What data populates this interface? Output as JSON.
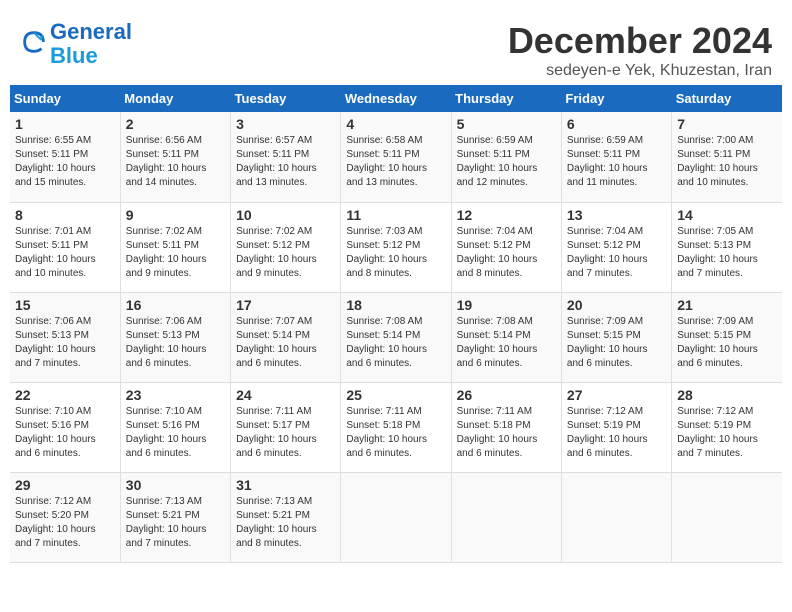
{
  "header": {
    "logo_line1": "General",
    "logo_line2": "Blue",
    "title": "December 2024",
    "subtitle": "sedeyen-e Yek, Khuzestan, Iran"
  },
  "weekdays": [
    "Sunday",
    "Monday",
    "Tuesday",
    "Wednesday",
    "Thursday",
    "Friday",
    "Saturday"
  ],
  "weeks": [
    [
      {
        "day": "1",
        "sunrise": "6:55 AM",
        "sunset": "5:11 PM",
        "daylight": "10 hours and 15 minutes."
      },
      {
        "day": "2",
        "sunrise": "6:56 AM",
        "sunset": "5:11 PM",
        "daylight": "10 hours and 14 minutes."
      },
      {
        "day": "3",
        "sunrise": "6:57 AM",
        "sunset": "5:11 PM",
        "daylight": "10 hours and 13 minutes."
      },
      {
        "day": "4",
        "sunrise": "6:58 AM",
        "sunset": "5:11 PM",
        "daylight": "10 hours and 13 minutes."
      },
      {
        "day": "5",
        "sunrise": "6:59 AM",
        "sunset": "5:11 PM",
        "daylight": "10 hours and 12 minutes."
      },
      {
        "day": "6",
        "sunrise": "6:59 AM",
        "sunset": "5:11 PM",
        "daylight": "10 hours and 11 minutes."
      },
      {
        "day": "7",
        "sunrise": "7:00 AM",
        "sunset": "5:11 PM",
        "daylight": "10 hours and 10 minutes."
      }
    ],
    [
      {
        "day": "8",
        "sunrise": "7:01 AM",
        "sunset": "5:11 PM",
        "daylight": "10 hours and 10 minutes."
      },
      {
        "day": "9",
        "sunrise": "7:02 AM",
        "sunset": "5:11 PM",
        "daylight": "10 hours and 9 minutes."
      },
      {
        "day": "10",
        "sunrise": "7:02 AM",
        "sunset": "5:12 PM",
        "daylight": "10 hours and 9 minutes."
      },
      {
        "day": "11",
        "sunrise": "7:03 AM",
        "sunset": "5:12 PM",
        "daylight": "10 hours and 8 minutes."
      },
      {
        "day": "12",
        "sunrise": "7:04 AM",
        "sunset": "5:12 PM",
        "daylight": "10 hours and 8 minutes."
      },
      {
        "day": "13",
        "sunrise": "7:04 AM",
        "sunset": "5:12 PM",
        "daylight": "10 hours and 7 minutes."
      },
      {
        "day": "14",
        "sunrise": "7:05 AM",
        "sunset": "5:13 PM",
        "daylight": "10 hours and 7 minutes."
      }
    ],
    [
      {
        "day": "15",
        "sunrise": "7:06 AM",
        "sunset": "5:13 PM",
        "daylight": "10 hours and 7 minutes."
      },
      {
        "day": "16",
        "sunrise": "7:06 AM",
        "sunset": "5:13 PM",
        "daylight": "10 hours and 6 minutes."
      },
      {
        "day": "17",
        "sunrise": "7:07 AM",
        "sunset": "5:14 PM",
        "daylight": "10 hours and 6 minutes."
      },
      {
        "day": "18",
        "sunrise": "7:08 AM",
        "sunset": "5:14 PM",
        "daylight": "10 hours and 6 minutes."
      },
      {
        "day": "19",
        "sunrise": "7:08 AM",
        "sunset": "5:14 PM",
        "daylight": "10 hours and 6 minutes."
      },
      {
        "day": "20",
        "sunrise": "7:09 AM",
        "sunset": "5:15 PM",
        "daylight": "10 hours and 6 minutes."
      },
      {
        "day": "21",
        "sunrise": "7:09 AM",
        "sunset": "5:15 PM",
        "daylight": "10 hours and 6 minutes."
      }
    ],
    [
      {
        "day": "22",
        "sunrise": "7:10 AM",
        "sunset": "5:16 PM",
        "daylight": "10 hours and 6 minutes."
      },
      {
        "day": "23",
        "sunrise": "7:10 AM",
        "sunset": "5:16 PM",
        "daylight": "10 hours and 6 minutes."
      },
      {
        "day": "24",
        "sunrise": "7:11 AM",
        "sunset": "5:17 PM",
        "daylight": "10 hours and 6 minutes."
      },
      {
        "day": "25",
        "sunrise": "7:11 AM",
        "sunset": "5:18 PM",
        "daylight": "10 hours and 6 minutes."
      },
      {
        "day": "26",
        "sunrise": "7:11 AM",
        "sunset": "5:18 PM",
        "daylight": "10 hours and 6 minutes."
      },
      {
        "day": "27",
        "sunrise": "7:12 AM",
        "sunset": "5:19 PM",
        "daylight": "10 hours and 6 minutes."
      },
      {
        "day": "28",
        "sunrise": "7:12 AM",
        "sunset": "5:19 PM",
        "daylight": "10 hours and 7 minutes."
      }
    ],
    [
      {
        "day": "29",
        "sunrise": "7:12 AM",
        "sunset": "5:20 PM",
        "daylight": "10 hours and 7 minutes."
      },
      {
        "day": "30",
        "sunrise": "7:13 AM",
        "sunset": "5:21 PM",
        "daylight": "10 hours and 7 minutes."
      },
      {
        "day": "31",
        "sunrise": "7:13 AM",
        "sunset": "5:21 PM",
        "daylight": "10 hours and 8 minutes."
      },
      null,
      null,
      null,
      null
    ]
  ],
  "labels": {
    "sunrise": "Sunrise:",
    "sunset": "Sunset:",
    "daylight": "Daylight:"
  }
}
